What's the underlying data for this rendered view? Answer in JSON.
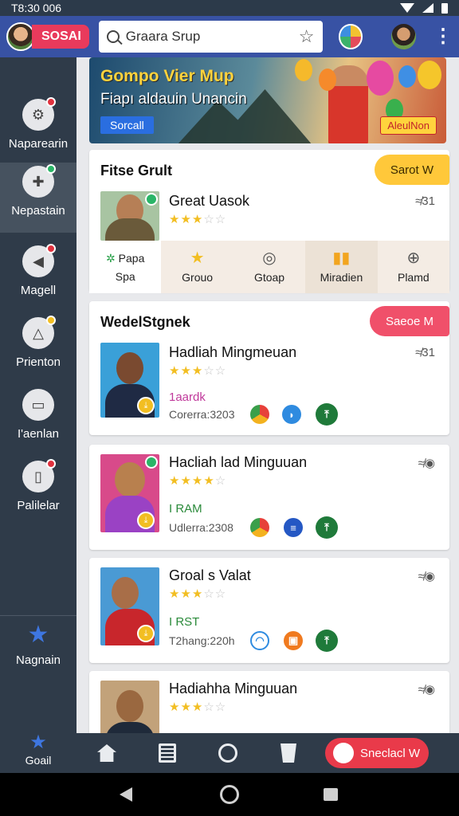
{
  "status_bar": {
    "time": "T8:30 006"
  },
  "appbar": {
    "brand": "SOSAI",
    "search_text": "Graara Srup"
  },
  "sidebar": {
    "items": [
      {
        "label": "Naparearin",
        "icon": "tools-icon"
      },
      {
        "label": "Nepastain",
        "icon": "gamepad-icon"
      },
      {
        "label": "Magell",
        "icon": "flag-icon"
      },
      {
        "label": "Prienton",
        "icon": "triangle-icon"
      },
      {
        "label": "I'aenlan",
        "icon": "box-icon"
      },
      {
        "label": "Palilelar",
        "icon": "door-icon"
      },
      {
        "label": "Nagnain",
        "icon": "star-icon"
      },
      {
        "label": "Goail",
        "icon": "star-icon"
      }
    ]
  },
  "banner": {
    "title": "Gompo Vier Mup",
    "subtitle": "Fiapı aldauin Unancin",
    "button": "Sorcall",
    "cta": "AleulNon"
  },
  "featured": {
    "heading": "Fitse Grult",
    "pill": "Sarot W",
    "item": {
      "title": "Great Uasok",
      "meta": "≉31",
      "rating": 3
    },
    "categories": [
      {
        "label": "Spa",
        "top": "Papa",
        "icon": "puzzle-icon"
      },
      {
        "label": "Grouo",
        "icon": "star-icon"
      },
      {
        "label": "Gtoap",
        "icon": "target-icon"
      },
      {
        "label": "Miradien",
        "icon": "bars-icon"
      },
      {
        "label": "Plamd",
        "icon": "globe-icon"
      }
    ]
  },
  "list_section": {
    "heading": "WedelStgnek",
    "pill": "Saeoe M",
    "items": [
      {
        "title": "Hadliah Mingmeuan",
        "meta": "≉31",
        "tag": "1aardk",
        "tag_color": "#c0399b",
        "sub": "Corerra:3203",
        "rating": 3
      },
      {
        "title": "Hacliah lad Minguuan",
        "meta": "≉◉",
        "tag": "I RAM",
        "tag_color": "#2a8a3a",
        "sub": "Udlerra:2308",
        "rating": 4
      },
      {
        "title": "Groal s Valat",
        "meta": "≉◉",
        "tag": "I RST",
        "tag_color": "#2a8a3a",
        "sub": "T2hang:220h",
        "rating": 3
      },
      {
        "title": "Hadiahha Minguuan",
        "meta": "≉◉",
        "tag": "",
        "tag_color": "#2a8a3a",
        "sub": "",
        "rating": 3
      }
    ]
  },
  "bottom_nav": {
    "cta": "Sneclacl W"
  },
  "colors": {
    "appbar": "#3852a4",
    "sidebar": "#2f3b49",
    "accent_red": "#e93a4a",
    "accent_yellow": "#ffc83a"
  }
}
